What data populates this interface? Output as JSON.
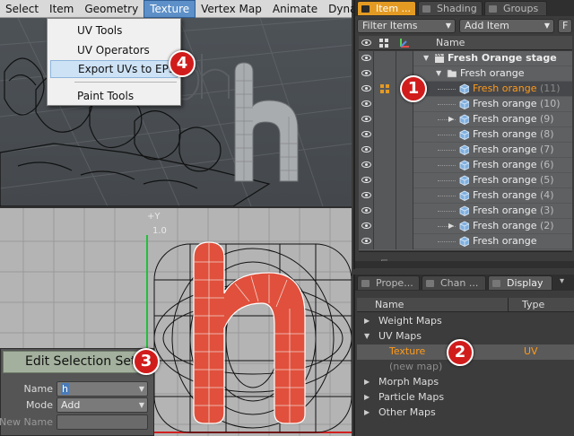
{
  "menubar": {
    "items": [
      "Select",
      "Item",
      "Geometry",
      "Texture",
      "Vertex Map",
      "Animate",
      "Dynamics"
    ],
    "active": "Texture"
  },
  "texture_menu": {
    "items": [
      "UV Tools",
      "UV Operators",
      "Export UVs to EPS...",
      "Paint Tools"
    ],
    "highlighted": "Export UVs to EPS..."
  },
  "uv_view": {
    "axis_label": "+Y",
    "axis_value": "1.0"
  },
  "edit_selection_set": {
    "title": "Edit Selection Set",
    "name_label": "Name",
    "name_value": "h",
    "mode_label": "Mode",
    "mode_value": "Add",
    "new_name_label": "New Name",
    "new_name_value": ""
  },
  "items_panel": {
    "tabs": [
      "Item ...",
      "Shading",
      "Groups"
    ],
    "active_tab": "Item ...",
    "filter_label": "Filter Items",
    "add_item_label": "Add Item",
    "f_label": "F",
    "column_name": "Name",
    "rows": [
      {
        "name": "Fresh Orange stage",
        "count": "",
        "indent": 0,
        "bold": true,
        "icon": "clapper-icon"
      },
      {
        "name": "Fresh orange",
        "count": "",
        "indent": 1,
        "icon": "group-folder-icon"
      },
      {
        "name": "Fresh orange",
        "count": "(11)",
        "indent": 2,
        "selected": true,
        "icon": "mesh-cube-icon"
      },
      {
        "name": "Fresh orange",
        "count": "(10)",
        "indent": 2,
        "icon": "mesh-cube-icon"
      },
      {
        "name": "Fresh orange",
        "count": "(9)",
        "indent": 2,
        "icon": "mesh-cube-icon",
        "expandable": true
      },
      {
        "name": "Fresh orange",
        "count": "(8)",
        "indent": 2,
        "icon": "mesh-cube-icon"
      },
      {
        "name": "Fresh orange",
        "count": "(7)",
        "indent": 2,
        "icon": "mesh-cube-icon"
      },
      {
        "name": "Fresh orange",
        "count": "(6)",
        "indent": 2,
        "icon": "mesh-cube-icon"
      },
      {
        "name": "Fresh orange",
        "count": "(5)",
        "indent": 2,
        "icon": "mesh-cube-icon"
      },
      {
        "name": "Fresh orange",
        "count": "(4)",
        "indent": 2,
        "icon": "mesh-cube-icon"
      },
      {
        "name": "Fresh orange",
        "count": "(3)",
        "indent": 2,
        "icon": "mesh-cube-icon"
      },
      {
        "name": "Fresh orange",
        "count": "(2)",
        "indent": 2,
        "icon": "mesh-cube-icon",
        "expandable": true
      },
      {
        "name": "Fresh orange",
        "count": "",
        "indent": 2,
        "icon": "mesh-cube-icon"
      }
    ]
  },
  "props_panel": {
    "tabs": [
      "Prope...",
      "Chan ...",
      "Display"
    ],
    "active_tab": "Display",
    "col_name": "Name",
    "col_type": "Type",
    "rows": [
      {
        "name": "Weight Maps",
        "type": "",
        "level": 0,
        "twist": "▶"
      },
      {
        "name": "UV Maps",
        "type": "",
        "level": 0,
        "twist": "▼"
      },
      {
        "name": "Texture",
        "type": "UV",
        "level": 1,
        "selected": true
      },
      {
        "name": "(new map)",
        "type": "",
        "level": 1,
        "dim": true
      },
      {
        "name": "Morph Maps",
        "type": "",
        "level": 0,
        "twist": "▶"
      },
      {
        "name": "Particle Maps",
        "type": "",
        "level": 0,
        "twist": "▶"
      },
      {
        "name": "Other Maps",
        "type": "",
        "level": 0,
        "twist": "▶"
      }
    ]
  },
  "callouts": [
    "1",
    "2",
    "3",
    "4"
  ],
  "colors": {
    "accent_orange": "#e39a23",
    "menu_highlight": "#5d90c8",
    "callout_red": "#d11c1c",
    "uv_fill": "#e0503c"
  }
}
